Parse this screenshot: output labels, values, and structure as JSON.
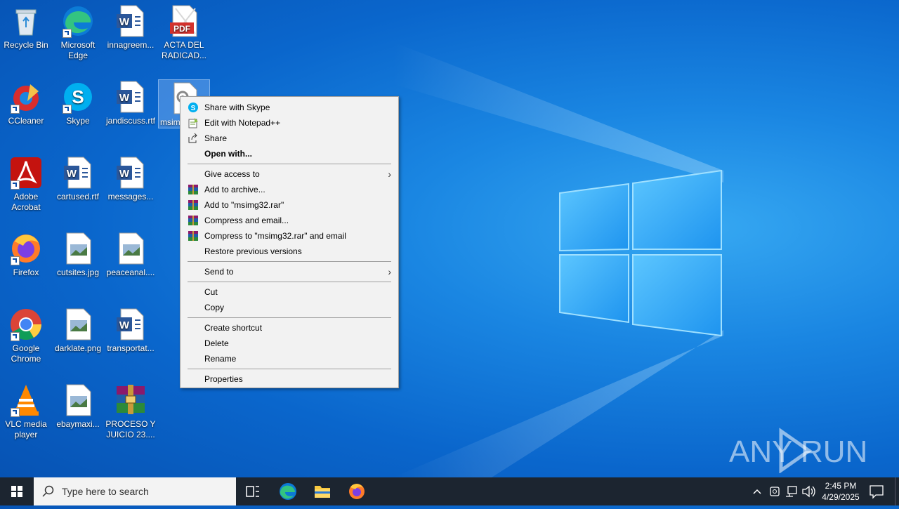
{
  "desktop_icons": [
    {
      "label": "Recycle Bin",
      "icon": "recycle-bin-icon"
    },
    {
      "label": "Microsoft Edge",
      "icon": "edge-icon"
    },
    {
      "label": "innagreem...",
      "icon": "word-document-icon"
    },
    {
      "label": "ACTA DEL RADICAD...",
      "icon": "pdf-icon"
    },
    {
      "label": "CCleaner",
      "icon": "ccleaner-icon"
    },
    {
      "label": "Skype",
      "icon": "skype-icon"
    },
    {
      "label": "jandiscuss.rtf",
      "icon": "word-document-icon"
    },
    {
      "label": "msim",
      "icon": "settings-file-icon"
    },
    {
      "label": "Adobe Acrobat",
      "icon": "acrobat-icon"
    },
    {
      "label": "cartused.rtf",
      "icon": "word-document-icon"
    },
    {
      "label": "messages...",
      "icon": "word-document-icon"
    },
    {
      "label": "Firefox",
      "icon": "firefox-icon"
    },
    {
      "label": "cutsites.jpg",
      "icon": "image-file-icon"
    },
    {
      "label": "peaceanal....",
      "icon": "image-file-icon"
    },
    {
      "label": "Google Chrome",
      "icon": "chrome-icon"
    },
    {
      "label": "darklate.png",
      "icon": "image-file-icon"
    },
    {
      "label": "transportat...",
      "icon": "word-document-icon"
    },
    {
      "label": "VLC media player",
      "icon": "vlc-icon"
    },
    {
      "label": "ebaymaxi...",
      "icon": "image-file-icon"
    },
    {
      "label": "PROCESO Y JUICIO 23....",
      "icon": "winrar-archive-icon"
    }
  ],
  "context_menu": {
    "share_skype": "Share with Skype",
    "edit_notepad": "Edit with Notepad++",
    "share": "Share",
    "open_with": "Open with...",
    "give_access": "Give access to",
    "add_archive": "Add to archive...",
    "add_rar": "Add to \"msimg32.rar\"",
    "compress_email": "Compress and email...",
    "compress_rar_email": "Compress to \"msimg32.rar\" and email",
    "restore": "Restore previous versions",
    "send_to": "Send to",
    "cut": "Cut",
    "copy": "Copy",
    "create_shortcut": "Create shortcut",
    "delete": "Delete",
    "rename": "Rename",
    "properties": "Properties"
  },
  "taskbar": {
    "search_placeholder": "Type here to search",
    "time": "2:45 PM",
    "date": "4/29/2025"
  },
  "watermark": "ANY RUN",
  "colors": {
    "accent": "#0078d7",
    "taskbar": "#1c2530",
    "menu_bg": "#f2f2f2"
  }
}
